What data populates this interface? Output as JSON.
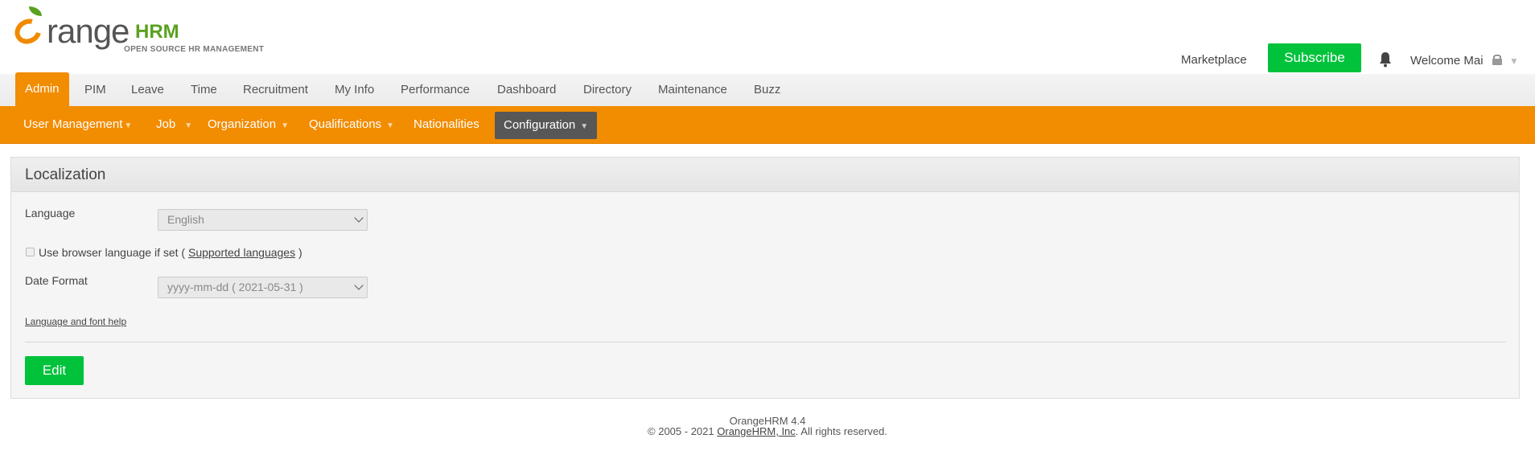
{
  "header": {
    "logo": {
      "word": "range",
      "brand": "HRM",
      "tagline": "OPEN SOURCE HR MANAGEMENT"
    },
    "marketplace": "Marketplace",
    "subscribe": "Subscribe",
    "welcome": "Welcome Mai"
  },
  "main_menu": [
    "Admin",
    "PIM",
    "Leave",
    "Time",
    "Recruitment",
    "My Info",
    "Performance",
    "Dashboard",
    "Directory",
    "Maintenance",
    "Buzz"
  ],
  "sub_menu": [
    "User Management",
    "Job",
    "Organization",
    "Qualifications",
    "Nationalities",
    "Configuration"
  ],
  "panel": {
    "title": "Localization",
    "language_label": "Language",
    "language_value": "English",
    "browser_lang_text": "Use browser language if set (",
    "supported_languages": "Supported languages",
    "browser_lang_close": ")",
    "date_format_label": "Date Format",
    "date_format_value": "yyyy-mm-dd ( 2021-05-31 )",
    "help_link": "Language and font help",
    "edit": "Edit"
  },
  "footer": {
    "version": "OrangeHRM 4.4",
    "copyright_prefix": "© 2005 - 2021",
    "company": "OrangeHRM, Inc",
    "rights": ". All rights reserved."
  },
  "colors": {
    "accent": "#f28c00",
    "button": "#00c23b",
    "active_sub": "#575757"
  }
}
